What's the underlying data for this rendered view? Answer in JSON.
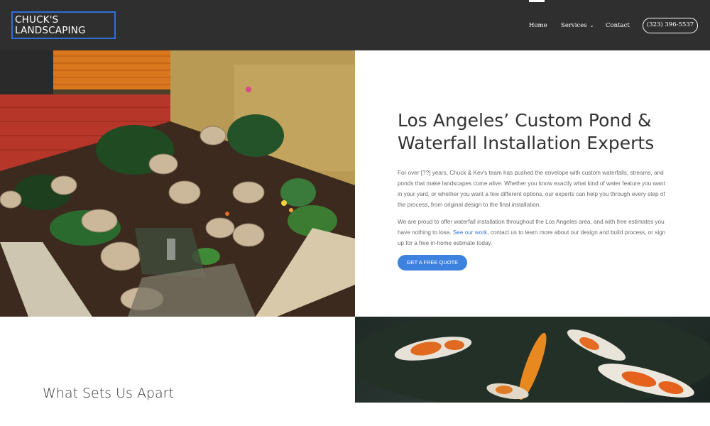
{
  "header": {
    "logo_line1": "CHUCK'S",
    "logo_line2": "LANDSCAPING",
    "nav": {
      "home": "Home",
      "services": "Services",
      "contact": "Contact"
    },
    "phone": "(323) 396-5537"
  },
  "hero": {
    "title": "Los Angeles’ Custom Pond & Waterfall Installation Experts",
    "paragraph1": "For over [??] years, Chuck & Kev's team has pushed the envelope with custom waterfalls, streams, and ponds that make landscapes come alive. Whether you know exactly what kind of water feature you want in your yard, or whether you want a few different options, our experts can help you through every step of the process, from original design to the final installation.",
    "paragraph2_before": "We are proud to offer waterfall installation throughout the Los Angeles area, and with free estimates you have nothing to lose. ",
    "paragraph2_link": "See our work",
    "paragraph2_after": ", contact us to learn more about our design and build process, or sign up for a free in-home estimate today.",
    "cta": "GET A FREE QUOTE"
  },
  "section": {
    "title": "What Sets Us Apart"
  },
  "colors": {
    "header_bg": "#2f2f2f",
    "accent": "#3e82e0",
    "logo_border": "#2f6fd6"
  }
}
